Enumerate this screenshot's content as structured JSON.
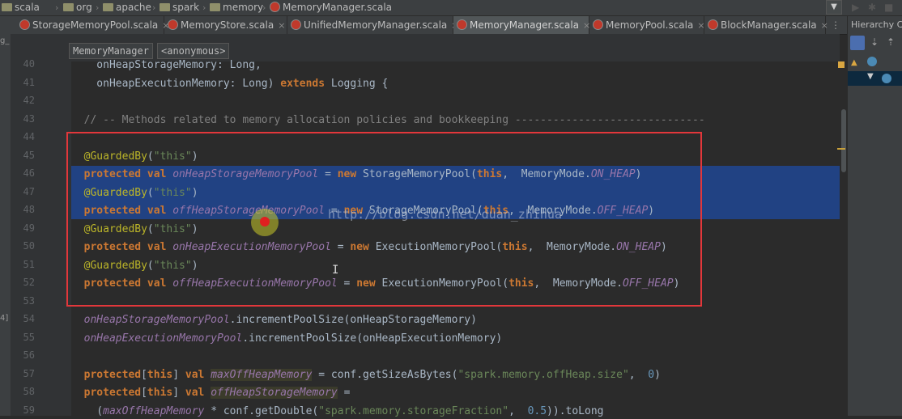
{
  "breadcrumbs": [
    "scala",
    "org",
    "apache",
    "spark",
    "memory",
    "MemoryManager.scala"
  ],
  "tabs": [
    {
      "label": "StorageMemoryPool.scala"
    },
    {
      "label": "MemoryStore.scala"
    },
    {
      "label": "UnifiedMemoryManager.scala"
    },
    {
      "label": "MemoryManager.scala"
    },
    {
      "label": "MemoryPool.scala"
    },
    {
      "label": "BlockManager.scala"
    }
  ],
  "tab_close": "×",
  "tab_more": "⋮",
  "right_panel": {
    "title": "Hierarchy C",
    "side_labels": [
      "g_",
      "4]"
    ]
  },
  "editor_breadcrumb": [
    "MemoryManager",
    "<anonymous>"
  ],
  "line_numbers": [
    "40",
    "41",
    "42",
    "43",
    "44",
    "45",
    "46",
    "47",
    "48",
    "49",
    "50",
    "51",
    "52",
    "53",
    "54",
    "55",
    "56",
    "57",
    "58",
    "59"
  ],
  "code_lines": [
    [
      {
        "t": "    onHeapStorageMemory: Long,",
        "c": ""
      }
    ],
    [
      {
        "t": "    onHeapExecutionMemory: Long) ",
        "c": ""
      },
      {
        "t": "extends",
        "c": "kw"
      },
      {
        "t": " Logging {",
        "c": ""
      }
    ],
    [],
    [
      {
        "t": "  // -- Methods related to memory allocation policies and bookkeeping ------------------------------",
        "c": "cmt"
      }
    ],
    [],
    [
      {
        "t": "  @GuardedBy",
        "c": "ann"
      },
      {
        "t": "(",
        "c": ""
      },
      {
        "t": "\"this\"",
        "c": "str"
      },
      {
        "t": ")",
        "c": ""
      }
    ],
    [
      {
        "t": "  protected val ",
        "c": "kw"
      },
      {
        "t": "onHeapStorageMemoryPool",
        "c": "fld"
      },
      {
        "t": " = ",
        "c": ""
      },
      {
        "t": "new ",
        "c": "kw"
      },
      {
        "t": "StorageMemoryPool(",
        "c": ""
      },
      {
        "t": "this",
        "c": "kw"
      },
      {
        "t": ",  MemoryMode.",
        "c": ""
      },
      {
        "t": "ON_HEAP",
        "c": "fld"
      },
      {
        "t": ")",
        "c": ""
      }
    ],
    [
      {
        "t": "  @GuardedBy",
        "c": "ann"
      },
      {
        "t": "(",
        "c": ""
      },
      {
        "t": "\"this\"",
        "c": "str"
      },
      {
        "t": ")",
        "c": ""
      }
    ],
    [
      {
        "t": "  protected val ",
        "c": "kw"
      },
      {
        "t": "offHeapStorageMemoryPool",
        "c": "fld"
      },
      {
        "t": " = ",
        "c": ""
      },
      {
        "t": "new ",
        "c": "kw"
      },
      {
        "t": "StorageMemoryPool(",
        "c": ""
      },
      {
        "t": "this",
        "c": "kw"
      },
      {
        "t": ",  MemoryMode.",
        "c": ""
      },
      {
        "t": "OFF_HEAP",
        "c": "fld"
      },
      {
        "t": ")",
        "c": ""
      }
    ],
    [
      {
        "t": "  @GuardedBy",
        "c": "ann"
      },
      {
        "t": "(",
        "c": ""
      },
      {
        "t": "\"this\"",
        "c": "str"
      },
      {
        "t": ")",
        "c": ""
      }
    ],
    [
      {
        "t": "  protected val ",
        "c": "kw"
      },
      {
        "t": "onHeapExecutionMemoryPool",
        "c": "fld"
      },
      {
        "t": " = ",
        "c": ""
      },
      {
        "t": "new ",
        "c": "kw"
      },
      {
        "t": "ExecutionMemoryPool(",
        "c": ""
      },
      {
        "t": "this",
        "c": "kw"
      },
      {
        "t": ",  MemoryMode.",
        "c": ""
      },
      {
        "t": "ON_HEAP",
        "c": "fld"
      },
      {
        "t": ")",
        "c": ""
      }
    ],
    [
      {
        "t": "  @GuardedBy",
        "c": "ann"
      },
      {
        "t": "(",
        "c": ""
      },
      {
        "t": "\"this\"",
        "c": "str"
      },
      {
        "t": ")",
        "c": ""
      }
    ],
    [
      {
        "t": "  protected val ",
        "c": "kw"
      },
      {
        "t": "offHeapExecutionMemoryPool",
        "c": "fld"
      },
      {
        "t": " = ",
        "c": ""
      },
      {
        "t": "new ",
        "c": "kw"
      },
      {
        "t": "ExecutionMemoryPool(",
        "c": ""
      },
      {
        "t": "this",
        "c": "kw"
      },
      {
        "t": ",  MemoryMode.",
        "c": ""
      },
      {
        "t": "OFF_HEAP",
        "c": "fld"
      },
      {
        "t": ")",
        "c": ""
      }
    ],
    [],
    [
      {
        "t": "  onHeapStorageMemoryPool",
        "c": "fld"
      },
      {
        "t": ".incrementPoolSize(onHeapStorageMemory)",
        "c": ""
      }
    ],
    [
      {
        "t": "  onHeapExecutionMemoryPool",
        "c": "fld"
      },
      {
        "t": ".incrementPoolSize(onHeapExecutionMemory)",
        "c": ""
      }
    ],
    [],
    [
      {
        "t": "  protected",
        "c": "kw"
      },
      {
        "t": "[",
        "c": ""
      },
      {
        "t": "this",
        "c": "kw"
      },
      {
        "t": "] ",
        "c": ""
      },
      {
        "t": "val ",
        "c": "kw"
      },
      {
        "t": "maxOffHeapMemory",
        "c": "fld hlv"
      },
      {
        "t": " = conf.getSizeAsBytes(",
        "c": ""
      },
      {
        "t": "\"spark.memory.offHeap.size\"",
        "c": "str"
      },
      {
        "t": ",  ",
        "c": ""
      },
      {
        "t": "0",
        "c": "num"
      },
      {
        "t": ")",
        "c": ""
      }
    ],
    [
      {
        "t": "  protected",
        "c": "kw"
      },
      {
        "t": "[",
        "c": ""
      },
      {
        "t": "this",
        "c": "kw"
      },
      {
        "t": "] ",
        "c": ""
      },
      {
        "t": "val ",
        "c": "kw"
      },
      {
        "t": "offHeapStorageMemory",
        "c": "fld hlv"
      },
      {
        "t": " =",
        "c": ""
      }
    ],
    [
      {
        "t": "    (",
        "c": ""
      },
      {
        "t": "maxOffHeapMemory",
        "c": "fld"
      },
      {
        "t": " * conf.getDouble(",
        "c": ""
      },
      {
        "t": "\"spark.memory.storageFraction\"",
        "c": "str"
      },
      {
        "t": ",  ",
        "c": ""
      },
      {
        "t": "0.5",
        "c": "num"
      },
      {
        "t": ")).toLong",
        "c": ""
      }
    ]
  ],
  "watermark": "http://blog.csdn.net/duan_zhihua",
  "text_cursor": "I"
}
